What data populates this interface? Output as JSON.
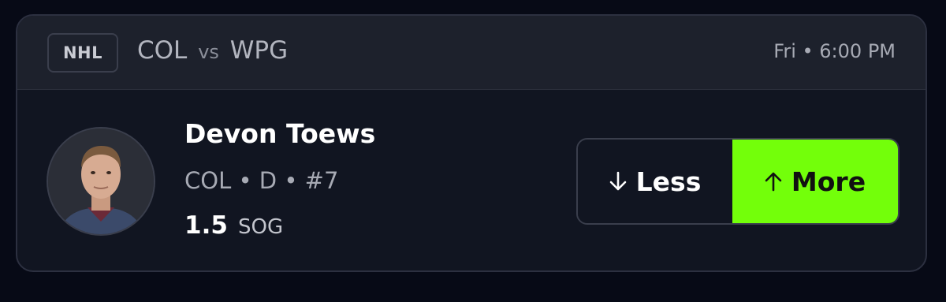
{
  "header": {
    "league": "NHL",
    "home_team": "COL",
    "vs_label": "vs",
    "away_team": "WPG",
    "game_time": "Fri • 6:00 PM"
  },
  "player": {
    "name": "Devon Toews",
    "meta": "COL • D • #7",
    "stat_value": "1.5",
    "stat_unit": "SOG"
  },
  "picks": {
    "less_label": "Less",
    "more_label": "More",
    "more_color": "#73ff0a",
    "less_icon": "arrow-down-icon",
    "more_icon": "arrow-up-icon"
  }
}
